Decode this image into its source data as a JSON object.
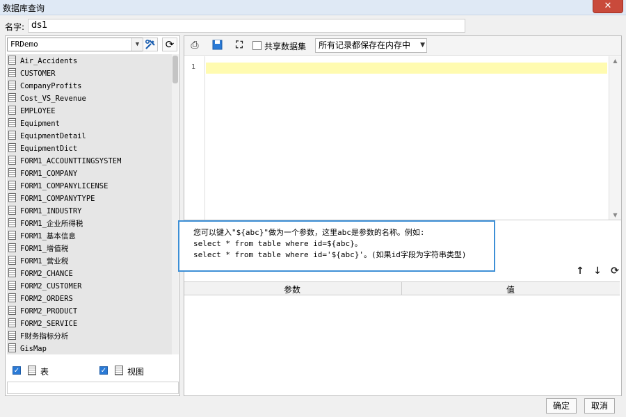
{
  "window": {
    "title": "数据库查询",
    "close_label": "✕"
  },
  "name_row": {
    "label": "名字:",
    "value": "ds1"
  },
  "left": {
    "database": "FRDemo",
    "tables": [
      "Air_Accidents",
      "CUSTOMER",
      "CompanyProfits",
      "Cost_VS_Revenue",
      "EMPLOYEE",
      "Equipment",
      "EquipmentDetail",
      "EquipmentDict",
      "FORM1_ACCOUNTTINGSYSTEM",
      "FORM1_COMPANY",
      "FORM1_COMPANYLICENSE",
      "FORM1_COMPANYTYPE",
      "FORM1_INDUSTRY",
      "FORM1_企业所得税",
      "FORM1_基本信息",
      "FORM1_增值税",
      "FORM1_营业税",
      "FORM2_CHANCE",
      "FORM2_CUSTOMER",
      "FORM2_ORDERS",
      "FORM2_PRODUCT",
      "FORM2_SERVICE",
      "F财务指标分析",
      "GisMap"
    ],
    "opt_table_label": "表",
    "opt_view_label": "视图"
  },
  "right": {
    "share_label": "共享数据集",
    "memory_option": "所有记录都保存在内存中",
    "line_number": "1",
    "param_col": "参数",
    "value_col": "值"
  },
  "hint": {
    "line1": "您可以键入\"${abc}\"做为一个参数，这里abc是参数的名称。例如:",
    "line2": "select * from table where id=${abc}。",
    "line3": "select * from table where id='${abc}'。(如果id字段为字符串类型)"
  },
  "buttons": {
    "ok": "确定",
    "cancel": "取消"
  }
}
